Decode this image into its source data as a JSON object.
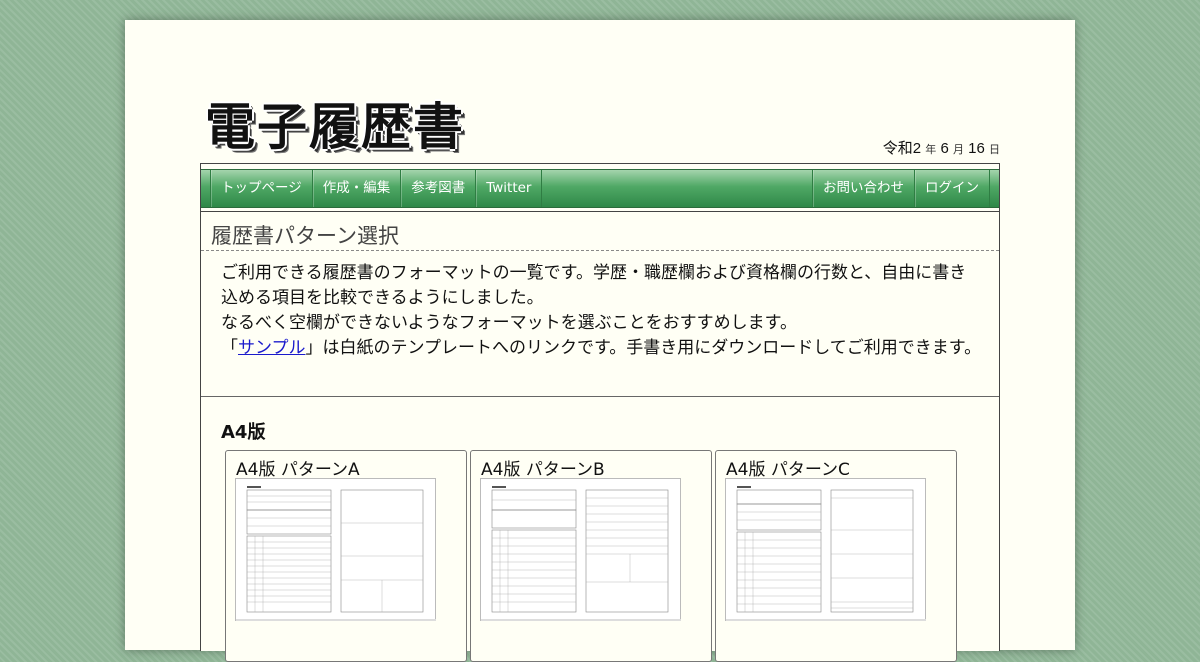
{
  "site": {
    "logo_text": "電子履歴書",
    "date": {
      "era_year": "令和2",
      "year_unit": "年",
      "month": "6",
      "month_unit": "月",
      "day": "16",
      "day_unit": "日"
    }
  },
  "nav": {
    "left": [
      {
        "label": "トップページ"
      },
      {
        "label": "作成・編集"
      },
      {
        "label": "参考図書"
      },
      {
        "label": "Twitter"
      }
    ],
    "right": [
      {
        "label": "お問い合わせ"
      },
      {
        "label": "ログイン"
      }
    ]
  },
  "main": {
    "heading": "履歴書パターン選択",
    "intro": {
      "line1": "ご利用できる履歴書のフォーマットの一覧です。学歴・職歴欄および資格欄の行数と、自由に書き込める項目を比較できるようにしました。",
      "line2": "なるべく空欄ができないようなフォーマットを選ぶことをおすすめします。",
      "quote_open": "「",
      "sample_link": "サンプル",
      "line3_rest": "」は白紙のテンプレートへのリンクです。手書き用にダウンロードしてご利用できます。"
    },
    "section_title": "A4版",
    "cards": [
      {
        "title": "A4版 パターンA",
        "thumbnail": "resume-template-thumbnail"
      },
      {
        "title": "A4版 パターンB",
        "thumbnail": "resume-template-thumbnail"
      },
      {
        "title": "A4版 パターンC",
        "thumbnail": "resume-template-thumbnail"
      }
    ]
  },
  "colors": {
    "nav_green": "#3f9a57",
    "background": "#8fb596",
    "page": "#fffff5",
    "link": "#1a1acc"
  }
}
